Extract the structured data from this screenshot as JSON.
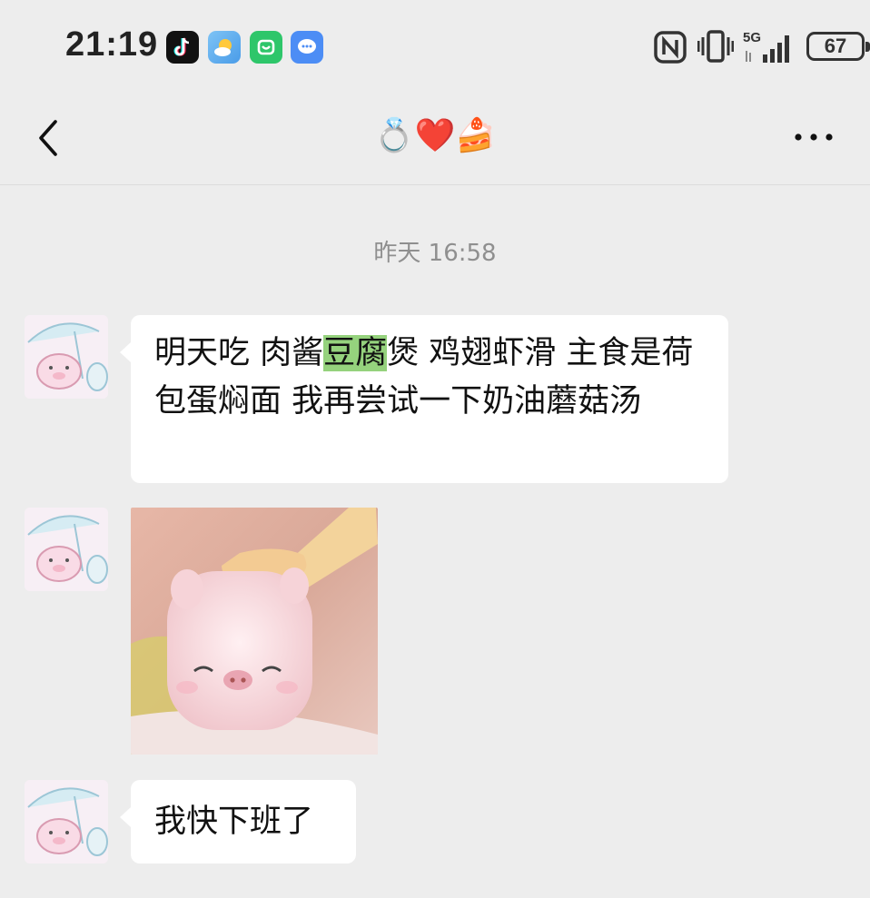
{
  "status_bar": {
    "time": "21:19",
    "battery": "67",
    "network": "5G",
    "app_icons": [
      "tiktok-icon",
      "weather-icon",
      "mi-home-icon",
      "messages-icon"
    ]
  },
  "nav": {
    "title": "💍❤️🍰",
    "back_icon": "chevron-left-icon",
    "more_icon": "more-dots-icon"
  },
  "chat": {
    "timestamp": "昨天 16:58",
    "messages": [
      {
        "type": "text",
        "before": "明天吃 肉酱",
        "highlight": "豆腐",
        "after": "煲 鸡翅虾滑 主食是荷包蛋焖面 我再尝试一下奶油蘑菇汤"
      },
      {
        "type": "sticker",
        "description_icon": "pig-sticker-image"
      },
      {
        "type": "text",
        "text": "我快下班了"
      }
    ]
  },
  "colors": {
    "background": "#ededed",
    "bubble": "#ffffff",
    "highlight": "#95d27d",
    "timestamp": "#8f8f8f"
  }
}
